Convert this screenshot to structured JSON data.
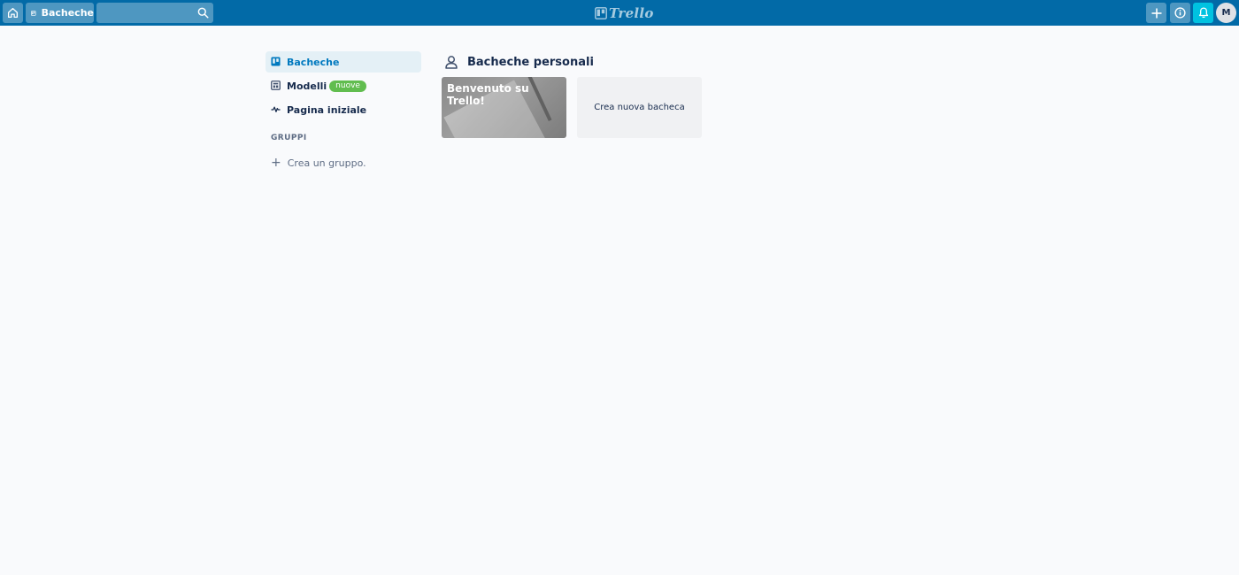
{
  "header": {
    "boards_label": "Bacheche",
    "search": {
      "value": "",
      "placeholder": ""
    },
    "logo_text": "Trello",
    "avatar_initial": "M",
    "colors": {
      "bar": "#026aa7",
      "notification": "#00c2e0"
    }
  },
  "sidebar": {
    "items": [
      {
        "label": "Bacheche",
        "icon": "board-icon",
        "active": true
      },
      {
        "label": "Modelli",
        "icon": "template-icon",
        "badge": "nuove"
      },
      {
        "label": "Pagina iniziale",
        "icon": "activity-icon"
      }
    ],
    "groups_title": "GRUPPI",
    "create_group_label": "Crea un gruppo."
  },
  "main": {
    "section_title": "Bacheche personali",
    "boards": [
      {
        "title": "Benvenuto su Trello!"
      }
    ],
    "create_board_label": "Crea nuova bacheca"
  }
}
